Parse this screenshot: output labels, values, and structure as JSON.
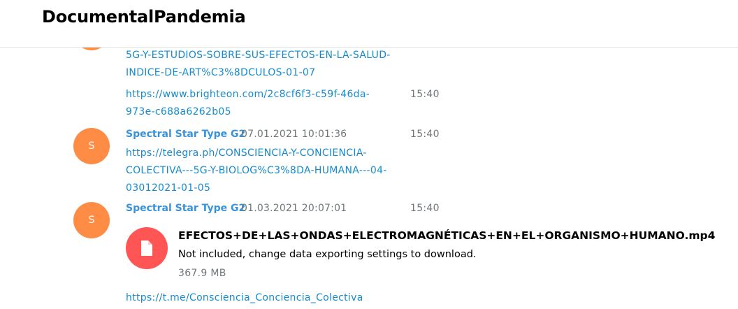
{
  "header": {
    "title": "DocumentalPandemia"
  },
  "messages": [
    {
      "link_lines": [
        "5G-Y-ESTUDIOS-SOBRE-SUS-EFECTOS-EN-LA-SALUD-",
        "INDICE-DE-ART%C3%8DCULOS-01-07"
      ],
      "time": ""
    },
    {
      "link_lines": [
        "https://www.brighteon.com/2c8cf6f3-c59f-46da-",
        "973e-c688a6262b05"
      ],
      "time": "15:40"
    },
    {
      "avatar_initial": "S",
      "sender": "Spectral Star Type G2",
      "date": "07.01.2021 10:01:36",
      "time": "15:40",
      "link_lines": [
        "https://telegra.ph/CONSCIENCIA-Y-CONCIENCIA-",
        "COLECTIVA---5G-Y-BIOLOG%C3%8DA-HUMANA---04-",
        "03012021-01-05"
      ]
    },
    {
      "avatar_initial": "S",
      "sender": "Spectral Star Type G2",
      "date": "01.03.2021 20:07:01",
      "time": "15:40",
      "file": {
        "icon": "file-icon",
        "title": "EFECTOS+DE+LAS+ONDAS+ELECTROMAGNÉTICAS+EN+EL+ORGANISMO+HUMANO.mp4",
        "note": "Not included, change data exporting settings to download.",
        "size": "367.9 MB"
      },
      "link": "https://t.me/Consciencia_Conciencia_Colectiva"
    }
  ],
  "colors": {
    "avatar": "#ff8c44",
    "file_icon_bg": "#ff5555",
    "link": "#168acd",
    "sender": "#3892db",
    "meta": "#70777b"
  }
}
